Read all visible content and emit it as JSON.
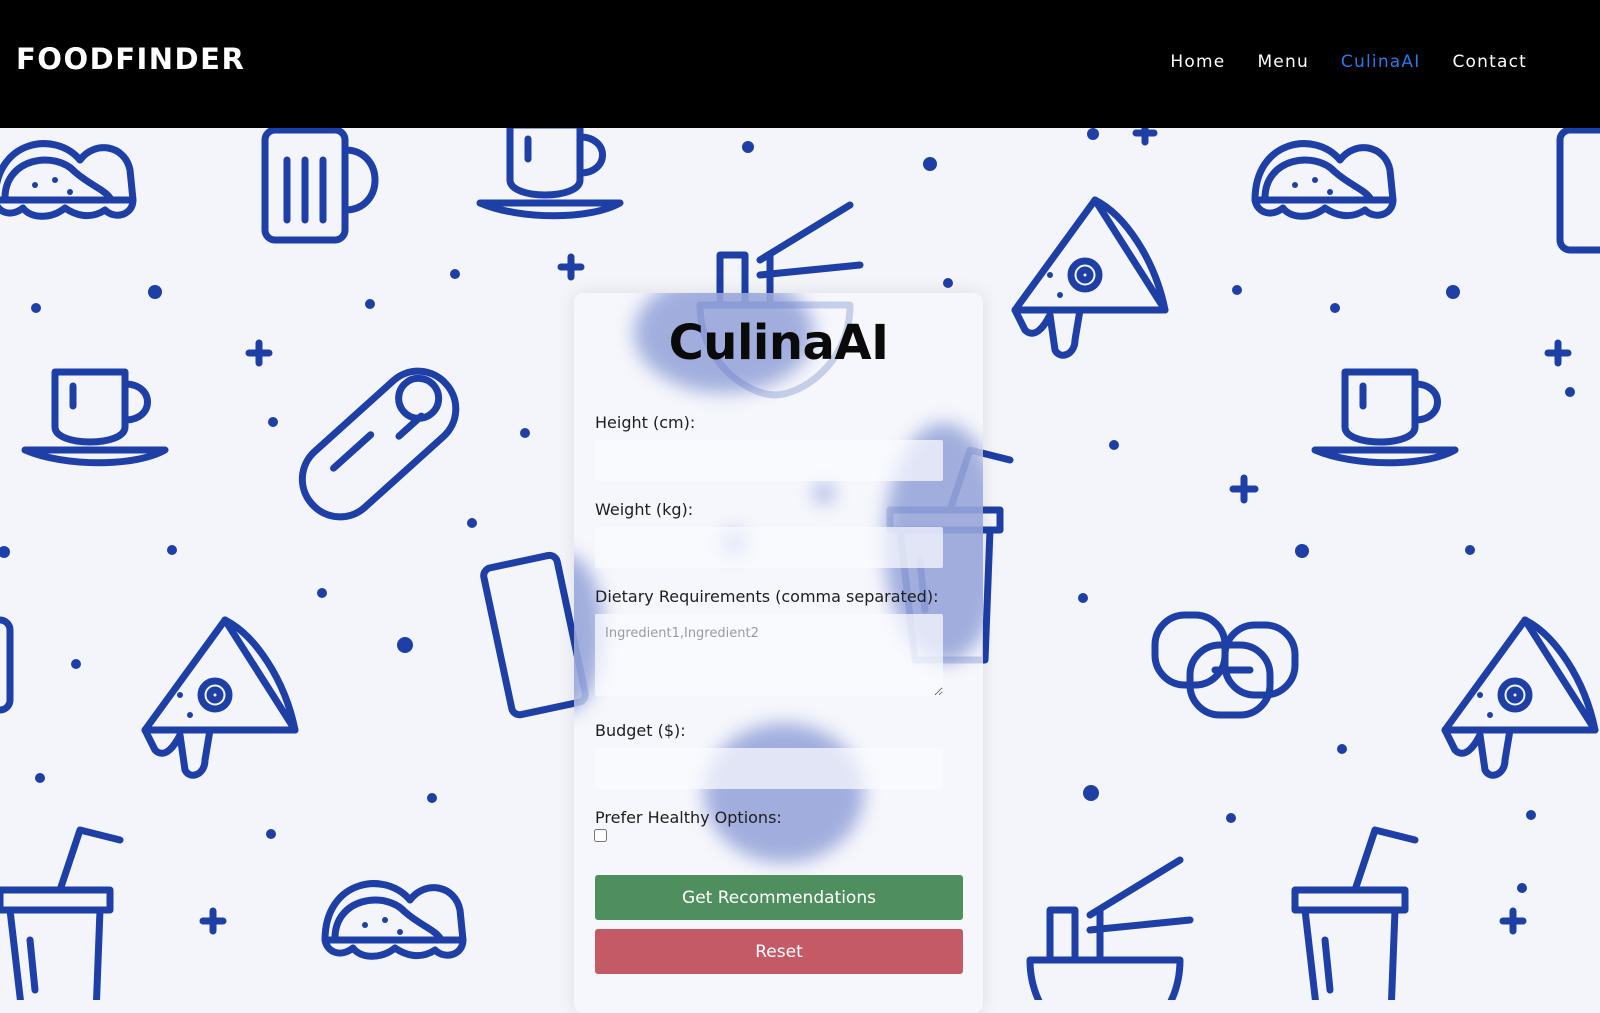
{
  "header": {
    "brand": "FOODFINDER",
    "nav": [
      "Home",
      "Menu",
      "CulinaAI",
      "Contact"
    ],
    "active_nav": "CulinaAI",
    "active_color": "#2a78e4"
  },
  "form": {
    "title": "CulinaAI",
    "height_label": "Height (cm):",
    "weight_label": "Weight (kg):",
    "dietary_label": "Dietary Requirements (comma separated):",
    "dietary_placeholder": "Ingredient1,Ingredient2",
    "budget_label": "Budget ($):",
    "healthy_label": "Prefer Healthy Options:",
    "submit_label": "Get Recommendations",
    "reset_label": "Reset"
  },
  "background": {
    "pattern_color": "#1d3fa6",
    "icons": [
      "taco-icon",
      "beer-mug-icon",
      "coffee-cup-icon",
      "noodle-bowl-icon",
      "pizza-slice-icon",
      "burrito-icon",
      "soda-cup-icon",
      "sushi-icon",
      "chocolate-bar-icon",
      "donut-icon"
    ]
  }
}
